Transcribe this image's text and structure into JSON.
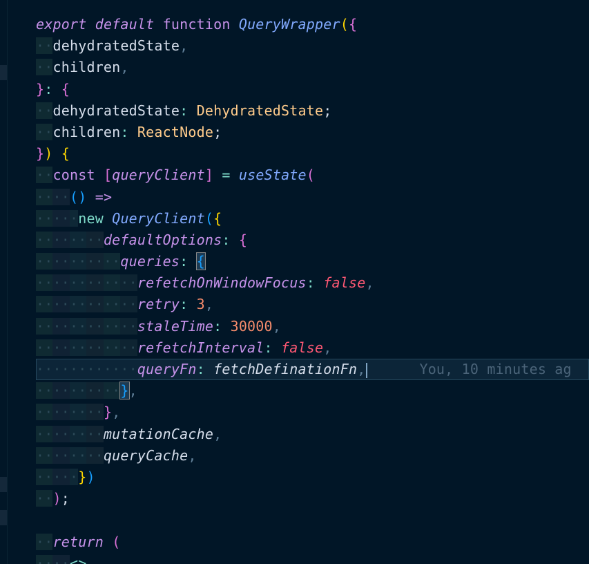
{
  "editor": {
    "blame_annotation": "You, 10 minutes ag",
    "colors": {
      "background": "#011627",
      "keyword": "#c792ea",
      "function": "#82aaff",
      "type": "#ffcb8b",
      "boolean": "#ff5874",
      "number": "#f78c6c",
      "bracket_gold": "#ffd700",
      "bracket_purple": "#da70d6",
      "bracket_blue": "#179fff"
    }
  },
  "code": {
    "l1": {
      "export": "export",
      "default": "default",
      "function": "function",
      "name": "QueryWrapper",
      "open_paren": "(",
      "open_brace": "{"
    },
    "l2": {
      "name": "dehydratedState",
      "comma": ","
    },
    "l3": {
      "name": "children",
      "comma": ","
    },
    "l4": {
      "close_brace": "}",
      "colon": ":",
      "open_brace": "{"
    },
    "l5": {
      "name": "dehydratedState",
      "colon": ":",
      "type": "DehydratedState",
      "semi": ";"
    },
    "l6": {
      "name": "children",
      "colon": ":",
      "type": "ReactNode",
      "semi": ";"
    },
    "l7": {
      "close_brace": "}",
      "close_paren": ")",
      "open_brace": "{"
    },
    "l8": {
      "const": "const",
      "open_bracket": "[",
      "name": "queryClient",
      "close_bracket": "]",
      "eq": "=",
      "fn": "useState",
      "open_paren": "("
    },
    "l9": {
      "parens": "()",
      "arrow": "=>"
    },
    "l10": {
      "new": "new",
      "cls": "QueryClient",
      "open_paren": "(",
      "open_brace": "{"
    },
    "l11": {
      "name": "defaultOptions",
      "colon": ":",
      "open_brace": "{"
    },
    "l12": {
      "name": "queries",
      "colon": ":",
      "open_brace": "{"
    },
    "l13": {
      "name": "refetchOnWindowFocus",
      "colon": ":",
      "value": "false",
      "comma": ","
    },
    "l14": {
      "name": "retry",
      "colon": ":",
      "value": "3",
      "comma": ","
    },
    "l15": {
      "name": "staleTime",
      "colon": ":",
      "value": "30000",
      "comma": ","
    },
    "l16": {
      "name": "refetchInterval",
      "colon": ":",
      "value": "false",
      "comma": ","
    },
    "l17": {
      "name": "queryFn",
      "colon": ":",
      "value": "fetchDefinationFn",
      "comma": ","
    },
    "l18": {
      "close_brace": "}",
      "comma": ","
    },
    "l19": {
      "close_brace": "}",
      "comma": ","
    },
    "l20": {
      "name": "mutationCache",
      "comma": ","
    },
    "l21": {
      "name": "queryCache",
      "comma": ","
    },
    "l22": {
      "close_brace": "}",
      "close_paren": ")"
    },
    "l23": {
      "close_paren": ")",
      "semi": ";"
    },
    "l24": {},
    "l25": {
      "return": "return",
      "open_paren": "("
    },
    "l26": {
      "tag": "<>"
    }
  }
}
